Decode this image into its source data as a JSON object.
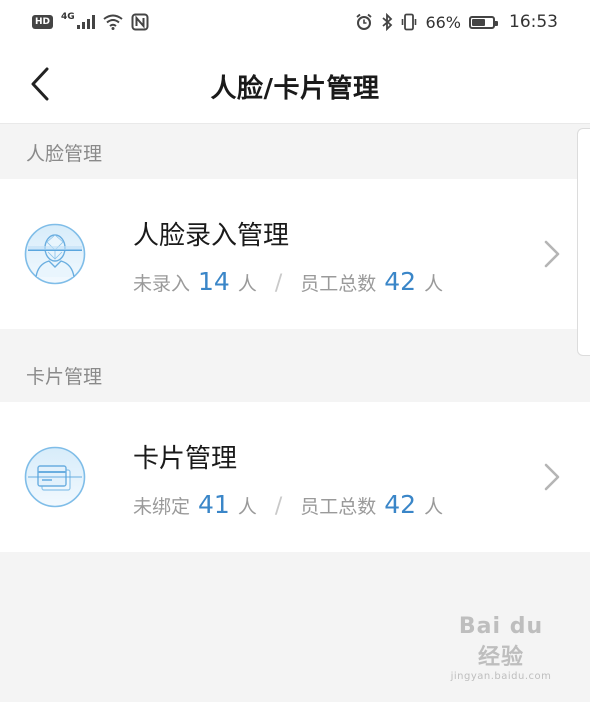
{
  "status_bar": {
    "hd_badge": "HD",
    "network": "4G",
    "battery_text": "66%",
    "battery_level": 0.66,
    "time": "16:53",
    "icons": [
      "signal-icon",
      "wifi-icon",
      "nfc-icon",
      "alarm-icon",
      "bluetooth-icon",
      "vibrate-icon",
      "battery-icon"
    ]
  },
  "nav": {
    "title": "人脸/卡片管理",
    "back_icon": "chevron-left-icon"
  },
  "sections": [
    {
      "header": "人脸管理",
      "card": {
        "title": "人脸录入管理",
        "icon": "face-scan-icon",
        "left_label": "未录入",
        "left_value": "14",
        "left_unit": "人",
        "separator": "/",
        "right_label": "员工总数",
        "right_value": "42",
        "right_unit": "人"
      }
    },
    {
      "header": "卡片管理",
      "card": {
        "title": "卡片管理",
        "icon": "card-icon",
        "left_label": "未绑定",
        "left_value": "41",
        "left_unit": "人",
        "separator": "/",
        "right_label": "员工总数",
        "right_value": "42",
        "right_unit": "人"
      }
    }
  ],
  "watermark": {
    "main": "Bai du 经验",
    "sub": "jingyan.baidu.com"
  },
  "colors": {
    "accent": "#3a86c8",
    "background": "#f4f4f4",
    "card": "#ffffff",
    "muted_text": "#9a9a9a"
  }
}
